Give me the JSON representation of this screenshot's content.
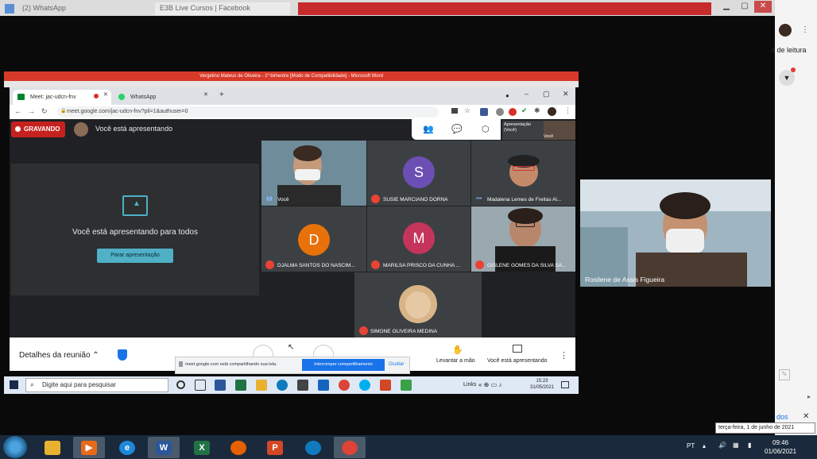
{
  "outer_browser": {
    "tabs": [
      "(2) WhatsApp",
      "E3B Live Cursos | Facebook"
    ]
  },
  "right_panel": {
    "reading_text": "a de leitura",
    "bottom_text": "dos"
  },
  "word_window": {
    "title": "Vergelino Mateus de Oliveira - 1º bimestre [Modo de Compatibilidade] - Microsoft Word"
  },
  "chrome": {
    "tabs": [
      {
        "label": "Meet: jac-udcn-fnv"
      },
      {
        "label": "WhatsApp"
      }
    ],
    "url": "meet.google.com/jac-udcn-fnv?pli=1&authuser=0"
  },
  "meet": {
    "recording_label": "GRAVANDO",
    "presenting_msg": "Você está apresentando",
    "presentation_box": {
      "message": "Você está apresentando para todos",
      "stop_button": "Parar apresentação"
    },
    "presentation_thumb": {
      "label_line1": "Apresentação",
      "label_line2": "(Você)",
      "you_label": "Você"
    },
    "participants": [
      {
        "name": "Você",
        "type": "video"
      },
      {
        "name": "SUSIE MARCIANO DORNA",
        "type": "letter",
        "letter": "S",
        "color": "#6c4fb4"
      },
      {
        "name": "Madalena Lemes de Freitas Al...",
        "type": "video"
      },
      {
        "name": "DJALMA SANTOS DO NASCIM...",
        "type": "letter",
        "letter": "D",
        "color": "#e8710a"
      },
      {
        "name": "MARILSA PRISCO DA CUNHA ...",
        "type": "letter",
        "letter": "M",
        "color": "#c5355b"
      },
      {
        "name": "GISLENE GOMES DA SILVA SA...",
        "type": "video"
      },
      {
        "name": "SIMONE OLIVEIRA MEDINA",
        "type": "photo"
      }
    ],
    "bottom_bar": {
      "details": "Detalhes da reunião",
      "raise_hand": "Levantar a mão",
      "you_presenting": "Você está apresentando"
    },
    "share_bar": {
      "message": "meet.google.com está compartilhando sua tela.",
      "stop_share": "Interromper compartilhamento",
      "hide": "Ocultar"
    }
  },
  "inner_taskbar": {
    "search_placeholder": "Digite aqui para pesquisar",
    "links": "Links",
    "time": "15:23",
    "date": "31/05/2021"
  },
  "side_video": {
    "name": "Rosilene de Assis Figueira"
  },
  "main_taskbar": {
    "language": "PT",
    "time": "09:46",
    "date": "01/06/2021",
    "tooltip": "terça-feira, 1 de junho de 2021"
  }
}
